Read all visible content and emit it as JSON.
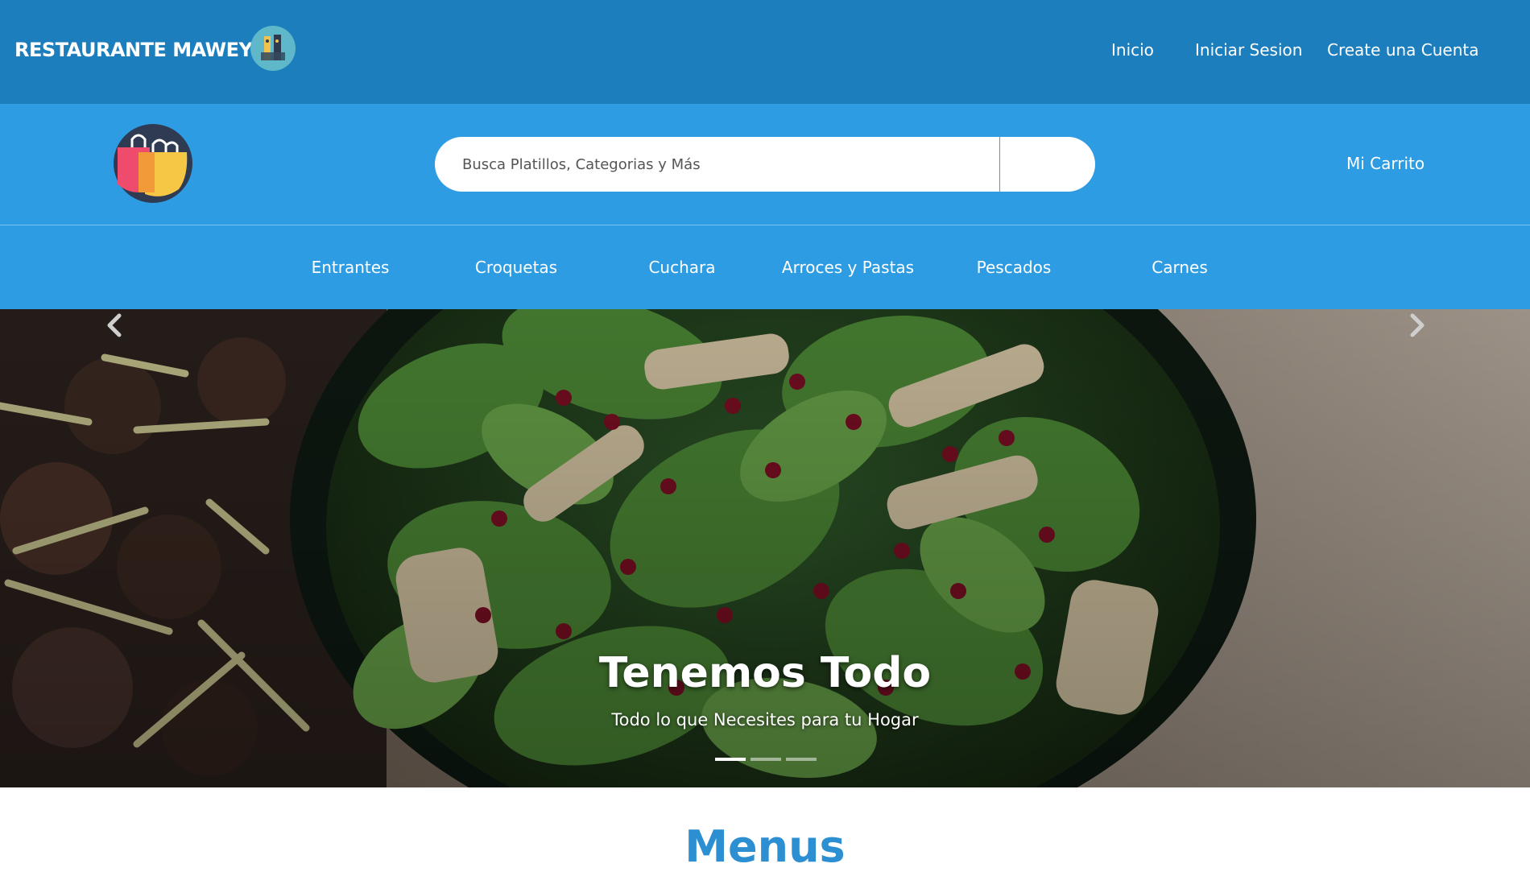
{
  "header": {
    "brand": "RESTAURANTE MAWEY",
    "nav": [
      {
        "label": "Inicio"
      },
      {
        "label": "Iniciar Sesion"
      },
      {
        "label": "Create una Cuenta"
      }
    ]
  },
  "search": {
    "placeholder": "Busca Platillos, Categorias y Más",
    "cart_label": "Mi Carrito"
  },
  "categories": [
    {
      "label": "Entrantes"
    },
    {
      "label": "Croquetas"
    },
    {
      "label": "Cuchara"
    },
    {
      "label": "Arroces y Pastas"
    },
    {
      "label": "Pescados"
    },
    {
      "label": "Carnes"
    }
  ],
  "hero": {
    "title": "Tenemos Todo",
    "subtitle": "Todo lo que Necesites para tu Hogar",
    "slide_count": 3,
    "active_slide": 1
  },
  "section": {
    "title": "Menus"
  },
  "colors": {
    "topbar": "#1c7ebd",
    "searchbar": "#2e9ce2",
    "section_title": "#2b8fd2"
  }
}
